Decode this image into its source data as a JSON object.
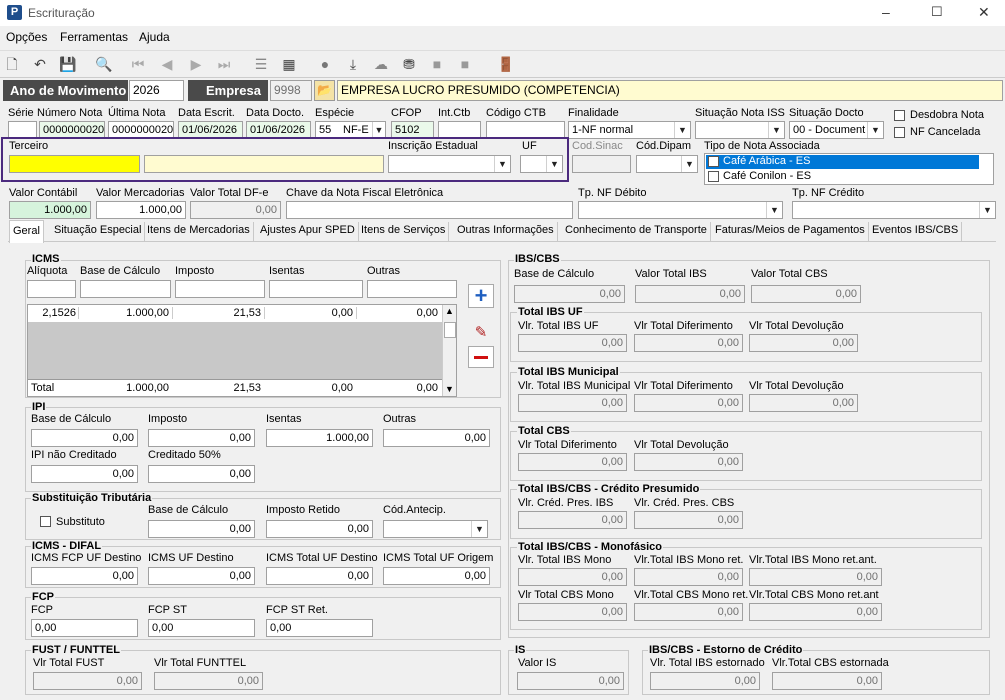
{
  "window": {
    "title": "Escrituração",
    "min": "–",
    "max": "☐",
    "close": "✕"
  },
  "menu": [
    "Opções",
    "Ferramentas",
    "Ajuda"
  ],
  "ano": {
    "label": "Ano de Movimento",
    "value": "2026"
  },
  "empresa": {
    "label": "Empresa",
    "code": "9998",
    "name": "EMPRESA LUCRO PRESUMIDO (COMPETENCIA)"
  },
  "nota": {
    "serie_lbl": "Série",
    "numero_lbl": "Número Nota",
    "numero": "0000000020",
    "ultima_lbl": "Última Nota",
    "ultima": "0000000020",
    "dataescr_lbl": "Data Escrit.",
    "dataescr": "01/06/2026",
    "datadocto_lbl": "Data Docto.",
    "datadocto": "01/06/2026",
    "especie_lbl": "Espécie",
    "especie_code": "55",
    "especie": "NF-E",
    "cfop_lbl": "CFOP",
    "cfop": "5102",
    "intctb_lbl": "Int.Ctb",
    "codctb_lbl": "Código CTB",
    "finalidade_lbl": "Finalidade",
    "finalidade": "1-NF normal",
    "sitiss_lbl": "Situação Nota ISS",
    "sitdocto_lbl": "Situação Docto",
    "sitdocto": "00 - Document",
    "desdobra": "Desdobra Nota",
    "cancelada": "NF Cancelada",
    "terceiro_lbl": "Terceiro",
    "ie_lbl": "Inscrição Estadual",
    "uf_lbl": "UF",
    "sinac_lbl": "Cod.Sinac",
    "dipam_lbl": "Cód.Dipam",
    "tiponota_lbl": "Tipo de Nota Associada",
    "tiponota_items": [
      "Café Arábica - ES",
      "Café Conilon - ES"
    ],
    "vcontabil_lbl": "Valor Contábil",
    "vcontabil": "1.000,00",
    "vmerc_lbl": "Valor Mercadorias",
    "vmerc": "1.000,00",
    "vdfe_lbl": "Valor Total DF-e",
    "vdfe": "0,00",
    "chave_lbl": "Chave da Nota Fiscal Eletrônica",
    "tpdeb_lbl": "Tp. NF Débito",
    "tpcred_lbl": "Tp. NF Crédito"
  },
  "tabs": [
    "Geral",
    "Situação Especial",
    "Itens de Mercadorias",
    "Ajustes Apur SPED",
    "Itens de Serviços",
    "Outras Informações",
    "Conhecimento de Transporte",
    "Faturas/Meios de Pagamentos",
    "Eventos IBS/CBS"
  ],
  "icms": {
    "title": "ICMS",
    "cols": [
      "Alíquota",
      "Base de Cálculo",
      "Imposto",
      "Isentas",
      "Outras"
    ],
    "row": [
      "2,1526",
      "1.000,00",
      "21,53",
      "0,00",
      "0,00"
    ],
    "total": [
      "Total",
      "1.000,00",
      "21,53",
      "0,00",
      "0,00"
    ]
  },
  "ipi": {
    "title": "IPI",
    "base_lbl": "Base de Cálculo",
    "base": "0,00",
    "imposto_lbl": "Imposto",
    "imposto": "0,00",
    "isentas_lbl": "Isentas",
    "isentas": "1.000,00",
    "outras_lbl": "Outras",
    "outras": "0,00",
    "naocred_lbl": "IPI não Creditado",
    "naocred": "0,00",
    "cred50_lbl": "Creditado 50%",
    "cred50": "0,00"
  },
  "st": {
    "title": "Substituição Tributária",
    "substituto": "Substituto",
    "base_lbl": "Base de Cálculo",
    "base": "0,00",
    "retido_lbl": "Imposto Retido",
    "retido": "0,00",
    "antecip_lbl": "Cód.Antecip."
  },
  "difal": {
    "title": "ICMS - DIFAL",
    "f1_lbl": "ICMS FCP UF Destino",
    "f1": "0,00",
    "f2_lbl": "ICMS UF Destino",
    "f2": "0,00",
    "f3_lbl": "ICMS Total UF Destino",
    "f3": "0,00",
    "f4_lbl": "ICMS Total UF Origem",
    "f4": "0,00"
  },
  "fcp": {
    "title": "FCP",
    "f1_lbl": "FCP",
    "f1": "0,00",
    "f2_lbl": "FCP ST",
    "f2": "0,00",
    "f3_lbl": "FCP ST Ret.",
    "f3": "0,00"
  },
  "fust": {
    "title": "FUST / FUNTTEL",
    "f1_lbl": "Vlr Total FUST",
    "f1": "0,00",
    "f2_lbl": "Vlr Total FUNTTEL",
    "f2": "0,00"
  },
  "ibscbs": {
    "title": "IBS/CBS",
    "base_lbl": "Base de Cálculo",
    "base": "0,00",
    "vibs_lbl": "Valor Total IBS",
    "vibs": "0,00",
    "vcbs_lbl": "Valor Total CBS",
    "vcbs": "0,00",
    "uf_title": "Total IBS UF",
    "uf1_lbl": "Vlr. Total IBS UF",
    "uf1": "0,00",
    "uf2_lbl": "Vlr Total Diferimento",
    "uf2": "0,00",
    "uf3_lbl": "Vlr Total Devolução",
    "uf3": "0,00",
    "mun_title": "Total IBS Municipal",
    "mun1_lbl": "Vlr. Total IBS Municipal",
    "mun1": "0,00",
    "mun2_lbl": "Vlr Total Diferimento",
    "mun2": "0,00",
    "mun3_lbl": "Vlr Total Devolução",
    "mun3": "0,00",
    "cbs_title": "Total CBS",
    "cbs1_lbl": "Vlr Total Diferimento",
    "cbs1": "0,00",
    "cbs2_lbl": "Vlr Total Devolução",
    "cbs2": "0,00",
    "pres_title": "Total IBS/CBS - Crédito Presumido",
    "pres1_lbl": "Vlr. Créd. Pres. IBS",
    "pres1": "0,00",
    "pres2_lbl": "Vlr. Créd. Pres. CBS",
    "pres2": "0,00",
    "mono_title": "Total IBS/CBS - Monofásico",
    "m1_lbl": "Vlr. Total IBS Mono",
    "m1": "0,00",
    "m2_lbl": "Vlr.Total IBS Mono ret.",
    "m2": "0,00",
    "m3_lbl": "Vlr.Total IBS Mono ret.ant.",
    "m3": "0,00",
    "m4_lbl": "Vlr Total CBS Mono",
    "m4": "0,00",
    "m5_lbl": "Vlr.Total CBS Mono ret.",
    "m5": "0,00",
    "m6_lbl": "Vlr.Total CBS Mono ret.ant",
    "m6": "0,00"
  },
  "is": {
    "title": "IS",
    "lbl": "Valor IS",
    "val": "0,00"
  },
  "estorno": {
    "title": "IBS/CBS - Estorno de Crédito",
    "f1_lbl": "Vlr. Total IBS estornado",
    "f1": "0,00",
    "f2_lbl": "Vlr.Total CBS estornada",
    "f2": "0,00"
  }
}
